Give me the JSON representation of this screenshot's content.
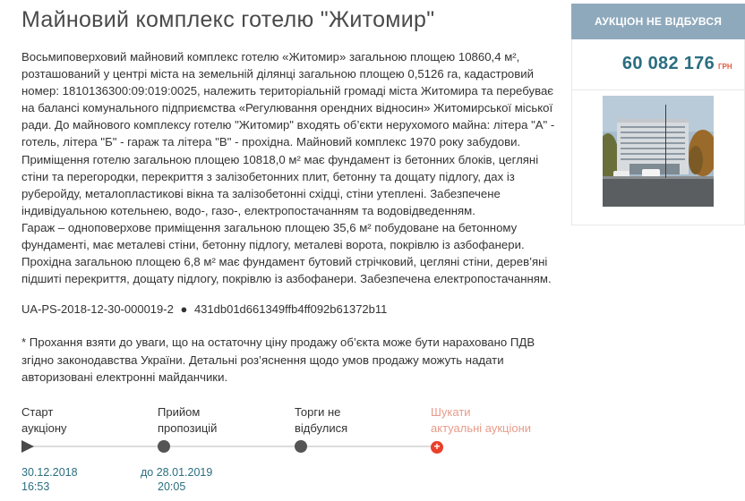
{
  "page": {
    "title": "Майновий комплекс готелю \"Житомир\""
  },
  "description": {
    "paragraphs": [
      "Восьмиповерховий майновий комплекс готелю «Житомир» загальною площею 10860,4 м², розташований у центрі міста на земельній ділянці загальною площею 0,5126 га, кадастровий номер: 1810136300:09:019:0025, належить територіальній громаді міста Житомира та перебуває на балансі комунального підприємства «Регулювання орендних відносин» Житомирської міської ради. До майнового комплексу готелю \"Житомир\" входять об’єкти нерухомого майна: літера \"А\" - готель, літера \"Б\" - гараж та літера \"В\" - прохідна. Майновий комплекс 1970 року забудови.",
      "Приміщення готелю загальною площею 10818,0 м² має фундамент із бетонних блоків, цегляні стіни та перегородки, перекриття з залізобетонних плит, бетонну та дощату підлогу, дах із руберойду, металопластикові вікна та залізобетонні східці, стіни утеплені. Забезпечене індивідуальною котельнею, водо-, газо-, електропостачанням та водовідведенням.",
      "Гараж – одноповерхове приміщення загальною площею 35,6 м² побудоване на бетонному фундаменті, має металеві стіни, бетонну підлогу, металеві ворота, покрівлю із азбофанери.",
      "Прохідна загальною площею 6,8 м² має фундамент бутовий стрічковий, цегляні стіни, дерев’яні підшиті перекриття, дощату підлогу, покрівлю із азбофанери. Забезпечена електропостачанням."
    ]
  },
  "auction_id": {
    "code": "UA-PS-2018-12-30-000019-2",
    "separator": "●",
    "hash": "431db01d661349ffb4ff092b61372b11"
  },
  "note": "* Прохання взяти до уваги, що на остаточну ціну продажу об’єкта може бути нараховано ПДВ згідно законодавства України. Детальні роз’яснення щодо умов продажу можуть надати авторизовані електронні майданчики.",
  "panel": {
    "status": "АУКЦІОН НЕ ВІДБУВСЯ",
    "price": "60 082 176",
    "currency": "ГРН",
    "status_color": "#8fa9bc",
    "price_color": "#2a6e80"
  },
  "timeline": {
    "steps": [
      {
        "label_line1": "Старт",
        "label_line2": "аукціону",
        "icon": "play-icon",
        "date_prefix": "",
        "date": "30.12.2018",
        "time": "16:53"
      },
      {
        "label_line1": "Прийом",
        "label_line2": "пропозицій",
        "icon": "dot-icon",
        "date_prefix": "до",
        "date": "28.01.2019",
        "time": "20:05"
      },
      {
        "label_line1": "Торги не",
        "label_line2": "відбулися",
        "icon": "dot-icon"
      },
      {
        "label_line1": "Шукати",
        "label_line2": "актуальні аукціони",
        "icon": "plus-icon"
      }
    ],
    "plus_glyph": "+",
    "accent_color": "#e8402c"
  }
}
